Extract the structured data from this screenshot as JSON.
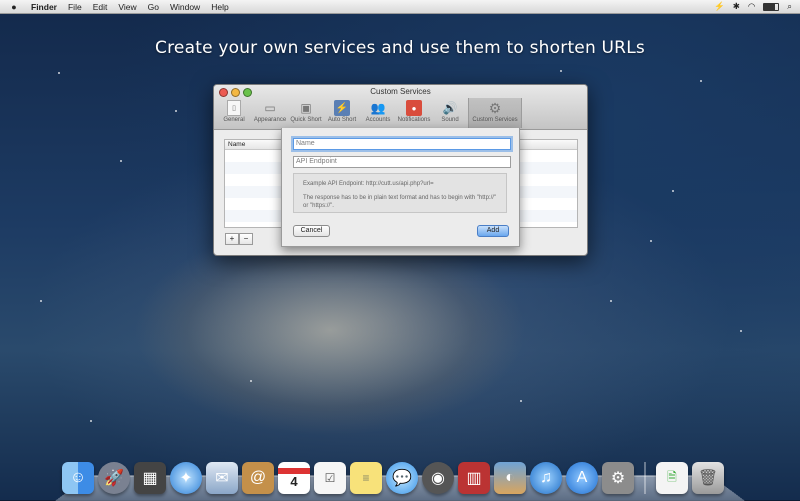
{
  "menubar": {
    "apple": "",
    "items": [
      "Finder",
      "File",
      "Edit",
      "View",
      "Go",
      "Window",
      "Help"
    ]
  },
  "headline": "Create your own services and use them to shorten URLs",
  "window": {
    "title": "Custom Services",
    "toolbar": [
      {
        "label": "General",
        "icon": "general-icon"
      },
      {
        "label": "Appearance",
        "icon": "appearance-icon"
      },
      {
        "label": "Quick Short",
        "icon": "quick-short-icon"
      },
      {
        "label": "Auto Short",
        "icon": "auto-short-icon"
      },
      {
        "label": "Accounts",
        "icon": "accounts-icon"
      },
      {
        "label": "Notifications",
        "icon": "notifications-icon"
      },
      {
        "label": "Sound",
        "icon": "sound-icon"
      },
      {
        "label": "Custom Services",
        "icon": "gear-icon"
      }
    ],
    "table": {
      "header": "Name"
    },
    "add_label": "+",
    "remove_label": "−"
  },
  "sheet": {
    "name_placeholder": "Name",
    "endpoint_placeholder": "API Endpoint",
    "example": "Example API Endpoint: http://cutt.us/api.php?url=",
    "note": "The response has to be in plain text format and has to begin with \"http://\" or \"https://\".",
    "cancel_label": "Cancel",
    "add_label": "Add"
  },
  "dock": [
    "Finder",
    "Launchpad",
    "Mission Control",
    "Safari",
    "Mail",
    "Contacts",
    "Calendar",
    "Reminders",
    "Notes",
    "Messages",
    "FaceTime",
    "Photo Booth",
    "iPhoto",
    "iTunes",
    "App Store",
    "System Preferences",
    "Documents",
    "Trash"
  ],
  "calendar_day": "4",
  "colors": {
    "accent": "#5b9ae6",
    "add_button": "#6aa7ee"
  }
}
